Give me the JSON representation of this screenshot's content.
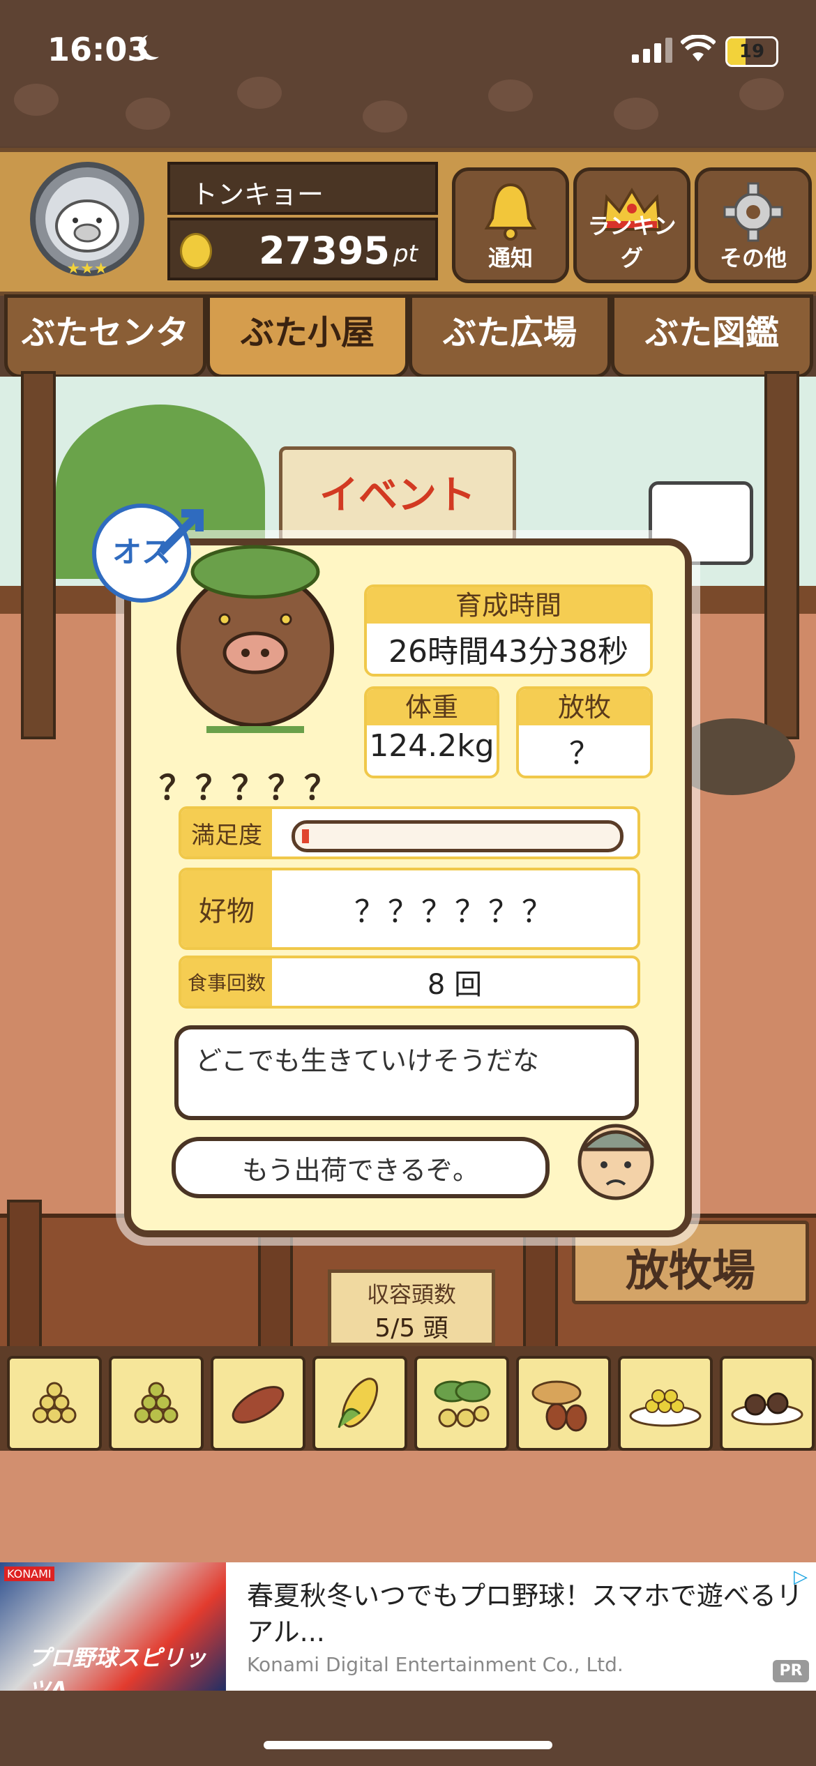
{
  "status_bar": {
    "time": "16:03",
    "battery": "19"
  },
  "header": {
    "player_name": "トンキョー",
    "points": "27395",
    "points_unit": "pt",
    "buttons": [
      {
        "label": "通知",
        "icon": "bell-icon"
      },
      {
        "label": "ランキング",
        "icon": "crown-icon"
      },
      {
        "label": "その他",
        "icon": "gear-icon"
      }
    ]
  },
  "tabs": [
    {
      "label": "ぶたセンター",
      "active": false
    },
    {
      "label": "ぶた小屋",
      "active": true
    },
    {
      "label": "ぶた広場",
      "active": false
    },
    {
      "label": "ぶた図鑑",
      "active": false
    }
  ],
  "scene": {
    "event_sign": "イベント"
  },
  "pig_card": {
    "gender": "オス",
    "name": "？？？？？",
    "growth_time_label": "育成時間",
    "growth_time": "26時間43分38秒",
    "weight_label": "体重",
    "weight": "124.2kg",
    "grazing_label": "放牧",
    "grazing": "？",
    "satisfaction_label": "満足度",
    "satisfaction": 0.02,
    "favorite_label": "好物",
    "favorite": "？？？？？？",
    "meals_label": "食事回数",
    "meals": "8 回",
    "speech_pig": "どこでも生きていけそうだな",
    "speech_farmer": "もう出荷できるぞ。"
  },
  "capacity": {
    "label": "収容頭数",
    "value": "5/5 頭"
  },
  "ranch_sign": "放牧場",
  "feeds": [
    "grain-pile-icon",
    "green-grain-icon",
    "sweet-potato-icon",
    "corn-icon",
    "leaf-berry-icon",
    "acorn-icon",
    "bean-plate-icon",
    "meatball-plate-icon"
  ],
  "ad": {
    "title": "春夏秋冬いつでもプロ野球！スマホで遊べるリアル...",
    "advertiser": "Konami Digital Entertainment Co., Ltd.",
    "badge": "PR",
    "image_text": "プロ野球スピリッツA",
    "brand": "KONAMI"
  }
}
